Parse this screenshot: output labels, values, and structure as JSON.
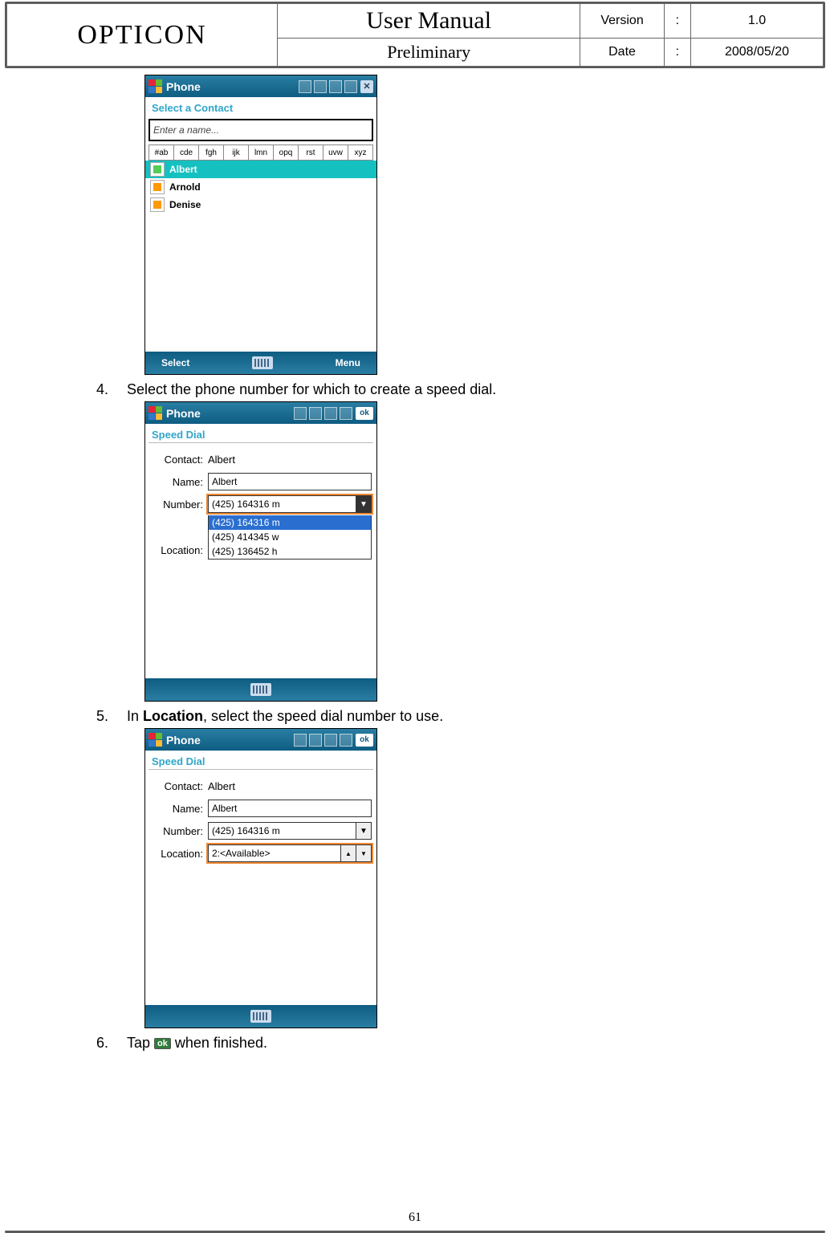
{
  "header": {
    "brand": "OPTICON",
    "title": "User Manual",
    "subtitle": "Preliminary",
    "meta": {
      "version_label": "Version",
      "version_value": "1.0",
      "date_label": "Date",
      "date_value": "2008/05/20",
      "colon": ":"
    }
  },
  "steps": {
    "s4": {
      "num": "4.",
      "text": "Select the phone number for which to create a speed dial."
    },
    "s5": {
      "num": "5.",
      "before": "In ",
      "bold": "Location",
      "after": ", select the speed dial number to use."
    },
    "s6": {
      "num": "6.",
      "before": "Tap ",
      "ok": "ok",
      "after": " when finished."
    }
  },
  "contactScreen": {
    "app": "Phone",
    "sub": "Select a Contact",
    "input_placeholder": "Enter a name...",
    "index": [
      "#ab",
      "cde",
      "fgh",
      "ijk",
      "lmn",
      "opq",
      "rst",
      "uvw",
      "xyz"
    ],
    "contacts": [
      {
        "name": "Albert",
        "selected": true,
        "iconColor": "green"
      },
      {
        "name": "Arnold",
        "selected": false,
        "iconColor": "orange"
      },
      {
        "name": "Denise",
        "selected": false,
        "iconColor": "orange"
      }
    ],
    "left": "Select",
    "right": "Menu"
  },
  "speedDial1": {
    "app": "Phone",
    "sub": "Speed Dial",
    "ok": "ok",
    "contact_label": "Contact:",
    "contact_value": "Albert",
    "name_label": "Name:",
    "name_value": "Albert",
    "number_label": "Number:",
    "number_value": "(425) 164316 m",
    "number_options": [
      "(425) 164316 m",
      "(425) 414345 w",
      "(425) 136452 h"
    ],
    "location_label": "Location:"
  },
  "speedDial2": {
    "app": "Phone",
    "sub": "Speed Dial",
    "ok": "ok",
    "contact_label": "Contact:",
    "contact_value": "Albert",
    "name_label": "Name:",
    "name_value": "Albert",
    "number_label": "Number:",
    "number_value": "(425) 164316 m",
    "location_label": "Location:",
    "location_value": "2:<Available>"
  },
  "page_number": "61"
}
